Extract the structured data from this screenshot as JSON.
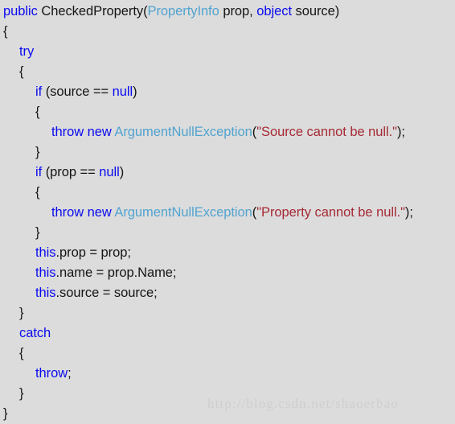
{
  "editor": {
    "background_color": "#dcdcdc",
    "keyword_color": "#0b0bef",
    "type_color": "#51a3cf",
    "string_color": "#a52a35",
    "text_color": "#151515",
    "language": "csharp"
  },
  "watermark": {
    "text": "http://blog.csdn.net/shaoerbao",
    "color": "#cfcfcf"
  },
  "code": {
    "lines": [
      {
        "indent": 0,
        "tokens": [
          {
            "t": "public",
            "k": "kw"
          },
          {
            "t": " CheckedProperty",
            "k": "plain"
          },
          {
            "t": "(",
            "k": "punct"
          },
          {
            "t": "PropertyInfo",
            "k": "type"
          },
          {
            "t": " prop, ",
            "k": "plain"
          },
          {
            "t": "object",
            "k": "kw"
          },
          {
            "t": " source)",
            "k": "plain"
          }
        ]
      },
      {
        "indent": 0,
        "tokens": [
          {
            "t": "{",
            "k": "punct"
          }
        ]
      },
      {
        "indent": 1,
        "tokens": [
          {
            "t": "try",
            "k": "kw"
          }
        ]
      },
      {
        "indent": 1,
        "tokens": [
          {
            "t": "{",
            "k": "punct"
          }
        ]
      },
      {
        "indent": 2,
        "tokens": [
          {
            "t": "if",
            "k": "kw"
          },
          {
            "t": " (source == ",
            "k": "plain"
          },
          {
            "t": "null",
            "k": "kw"
          },
          {
            "t": ")",
            "k": "plain"
          }
        ]
      },
      {
        "indent": 2,
        "tokens": [
          {
            "t": "{",
            "k": "punct"
          }
        ]
      },
      {
        "indent": 3,
        "tokens": [
          {
            "t": "throw new",
            "k": "kw"
          },
          {
            "t": " ",
            "k": "plain"
          },
          {
            "t": "ArgumentNullException",
            "k": "type"
          },
          {
            "t": "(",
            "k": "punct"
          },
          {
            "t": "\"Source cannot be null.\"",
            "k": "str"
          },
          {
            "t": ");",
            "k": "punct"
          }
        ]
      },
      {
        "indent": 2,
        "tokens": [
          {
            "t": "}",
            "k": "punct"
          }
        ]
      },
      {
        "indent": 2,
        "tokens": [
          {
            "t": "if",
            "k": "kw"
          },
          {
            "t": " (prop == ",
            "k": "plain"
          },
          {
            "t": "null",
            "k": "kw"
          },
          {
            "t": ")",
            "k": "plain"
          }
        ]
      },
      {
        "indent": 2,
        "tokens": [
          {
            "t": "{",
            "k": "punct"
          }
        ]
      },
      {
        "indent": 3,
        "tokens": [
          {
            "t": "throw new",
            "k": "kw"
          },
          {
            "t": " ",
            "k": "plain"
          },
          {
            "t": "ArgumentNullException",
            "k": "type"
          },
          {
            "t": "(",
            "k": "punct"
          },
          {
            "t": "\"Property cannot be null.\"",
            "k": "str"
          },
          {
            "t": ");",
            "k": "punct"
          }
        ]
      },
      {
        "indent": 2,
        "tokens": [
          {
            "t": "}",
            "k": "punct"
          }
        ]
      },
      {
        "indent": 2,
        "tokens": [
          {
            "t": "this",
            "k": "kw"
          },
          {
            "t": ".prop = prop;",
            "k": "plain"
          }
        ]
      },
      {
        "indent": 2,
        "tokens": [
          {
            "t": "this",
            "k": "kw"
          },
          {
            "t": ".name = prop.Name;",
            "k": "plain"
          }
        ]
      },
      {
        "indent": 2,
        "tokens": [
          {
            "t": "this",
            "k": "kw"
          },
          {
            "t": ".source = source;",
            "k": "plain"
          }
        ]
      },
      {
        "indent": 1,
        "tokens": [
          {
            "t": "}",
            "k": "punct"
          }
        ]
      },
      {
        "indent": 1,
        "tokens": [
          {
            "t": "catch",
            "k": "kw"
          }
        ]
      },
      {
        "indent": 1,
        "tokens": [
          {
            "t": "{",
            "k": "punct"
          }
        ]
      },
      {
        "indent": 2,
        "tokens": [
          {
            "t": "throw",
            "k": "kw"
          },
          {
            "t": ";",
            "k": "punct"
          }
        ]
      },
      {
        "indent": 1,
        "tokens": [
          {
            "t": "}",
            "k": "punct"
          }
        ]
      },
      {
        "indent": 0,
        "tokens": [
          {
            "t": "}",
            "k": "punct"
          }
        ]
      }
    ]
  }
}
